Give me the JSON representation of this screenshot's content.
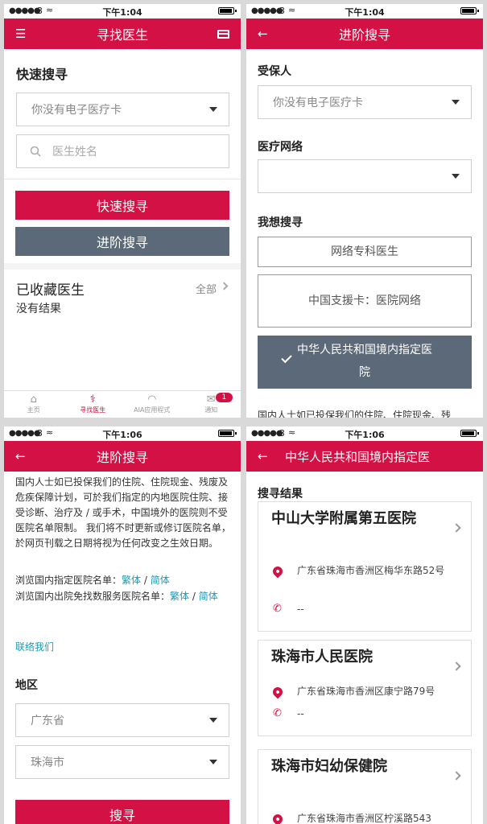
{
  "status": {
    "signal": "●●●●●",
    "carrier": "3",
    "wifi": "≈",
    "time1": "下午1:04",
    "time2": "下午1:06"
  },
  "colors": {
    "brand": "#d31145",
    "slate": "#5c6978",
    "link": "#1a9ab4"
  },
  "p1": {
    "title": "寻找医生",
    "quick_title": "快速搜寻",
    "card_select": "你没有电子医疗卡",
    "name_placeholder": "医生姓名",
    "quick_btn": "快速搜寻",
    "adv_btn": "进阶搜寻",
    "fav_title": "已收藏医生",
    "fav_all": "全部",
    "fav_empty": "没有结果",
    "tabs": [
      {
        "label": "主页",
        "icon": "⌂"
      },
      {
        "label": "寻找医生",
        "icon": "⚕"
      },
      {
        "label": "AIA应用程式",
        "icon": "◠"
      },
      {
        "label": "通知",
        "icon": "✉",
        "badge": "1"
      }
    ]
  },
  "p2": {
    "title": "进阶搜寻",
    "insured_label": "受保人",
    "insured_value": "你没有电子医疗卡",
    "network_label": "医疗网络",
    "network_value": "",
    "want_label": "我想搜寻",
    "opt1": "网络专科医生",
    "opt2": "中国支援卡：医院网络",
    "opt3": "中华人民共和国境内指定医院",
    "footer_text": "国内人士如已投保我们的住院、住院现金、残"
  },
  "p3": {
    "title": "进阶搜寻",
    "para": "国内人士如已投保我们的住院、住院现金、残废及危疾保障计划，可於我们指定的内地医院住院、接受诊断、治疗及 / 或手术，中国境外的医院则不受医院名单限制。 我们将不时更新或修订医院名单，於网页刊载之日期将视为任何改变之生效日期。",
    "list1_label": "浏览国内指定医院名单：",
    "list1_a": "繁体",
    "list1_sep": " / ",
    "list1_b": "简体",
    "list2_label": "浏览国内出院免找数服务医院名单：",
    "list2_a": "繁体",
    "list2_sep": " / ",
    "list2_b": "简体",
    "contact": "联络我们",
    "region_label": "地区",
    "province": "广东省",
    "city": "珠海市",
    "search_btn": "搜寻"
  },
  "p4": {
    "title": "中华人民共和国境内指定医",
    "results_label": "搜寻结果",
    "hospitals": [
      {
        "name": "中山大学附属第五医院",
        "address": "广东省珠海市香洲区梅华东路52号",
        "phone": "--"
      },
      {
        "name": "珠海市人民医院",
        "address": "广东省珠海市香洲区康宁路79号",
        "phone": "--"
      },
      {
        "name": "珠海市妇幼保健院",
        "address": "广东省珠海市香洲区柠溪路543",
        "phone": ""
      }
    ]
  }
}
